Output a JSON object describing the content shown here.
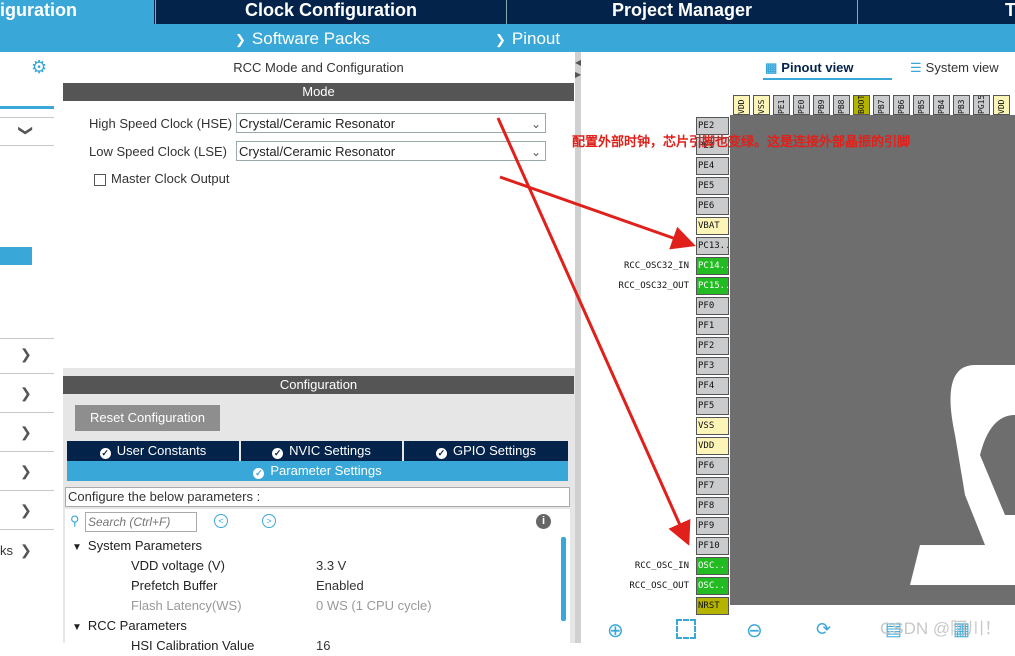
{
  "top_tabs": [
    "iguration",
    "Clock Configuration",
    "Project Manager",
    "T"
  ],
  "sub_menu": [
    "Software Packs",
    "Pinout"
  ],
  "rcc_panel": {
    "title": "RCC Mode and Configuration",
    "mode_header": "Mode",
    "hse_label": "High Speed Clock (HSE)",
    "hse_value": "Crystal/Ceramic Resonator",
    "lse_label": "Low Speed Clock (LSE)",
    "lse_value": "Crystal/Ceramic Resonator",
    "mco_label": "Master Clock Output"
  },
  "config_panel": {
    "header": "Configuration",
    "reset_button": "Reset Configuration",
    "tabs": [
      "User Constants",
      "NVIC Settings",
      "GPIO Settings"
    ],
    "active_tab": "Parameter Settings",
    "hint": "Configure the below parameters :",
    "search_placeholder": "Search (Ctrl+F)",
    "groups": [
      {
        "name": "System Parameters",
        "params": [
          {
            "name": "VDD voltage (V)",
            "value": "3.3 V"
          },
          {
            "name": "Prefetch Buffer",
            "value": "Enabled"
          },
          {
            "name": "Flash Latency(WS)",
            "value": "0 WS (1 CPU cycle)"
          }
        ]
      },
      {
        "name": "RCC Parameters",
        "params": [
          {
            "name": "HSI Calibration Value",
            "value": "16"
          }
        ]
      }
    ]
  },
  "sidebar": {
    "partial_label": "ks"
  },
  "view_tabs": {
    "pinout": "Pinout view",
    "system": "System view"
  },
  "left_pins": [
    {
      "name": "PE2",
      "color": "grey"
    },
    {
      "name": "PE3",
      "color": "grey"
    },
    {
      "name": "PE4",
      "color": "grey"
    },
    {
      "name": "PE5",
      "color": "grey"
    },
    {
      "name": "PE6",
      "color": "grey"
    },
    {
      "name": "VBAT",
      "color": "yellow"
    },
    {
      "name": "PC13..",
      "color": "grey"
    },
    {
      "name": "PC14..",
      "color": "green",
      "signal": "RCC_OSC32_IN"
    },
    {
      "name": "PC15..",
      "color": "green",
      "signal": "RCC_OSC32_OUT"
    },
    {
      "name": "PF0",
      "color": "grey"
    },
    {
      "name": "PF1",
      "color": "grey"
    },
    {
      "name": "PF2",
      "color": "grey"
    },
    {
      "name": "PF3",
      "color": "grey"
    },
    {
      "name": "PF4",
      "color": "grey"
    },
    {
      "name": "PF5",
      "color": "grey"
    },
    {
      "name": "VSS",
      "color": "yellow"
    },
    {
      "name": "VDD",
      "color": "yellow"
    },
    {
      "name": "PF6",
      "color": "grey"
    },
    {
      "name": "PF7",
      "color": "grey"
    },
    {
      "name": "PF8",
      "color": "grey"
    },
    {
      "name": "PF9",
      "color": "grey"
    },
    {
      "name": "PF10",
      "color": "grey"
    },
    {
      "name": "OSC..",
      "color": "green",
      "signal": "RCC_OSC_IN"
    },
    {
      "name": "OSC..",
      "color": "green",
      "signal": "RCC_OSC_OUT"
    },
    {
      "name": "NRST",
      "color": "olive"
    }
  ],
  "top_pins": [
    {
      "name": "VDD",
      "color": "yellow"
    },
    {
      "name": "VSS",
      "color": "yellow"
    },
    {
      "name": "PE1",
      "color": "grey"
    },
    {
      "name": "PE0",
      "color": "grey"
    },
    {
      "name": "PB9",
      "color": "grey"
    },
    {
      "name": "PB8",
      "color": "grey"
    },
    {
      "name": "BOOT0",
      "color": "olive"
    },
    {
      "name": "PB7",
      "color": "grey"
    },
    {
      "name": "PB6",
      "color": "grey"
    },
    {
      "name": "PB5",
      "color": "grey"
    },
    {
      "name": "PB4",
      "color": "grey"
    },
    {
      "name": "PB3",
      "color": "grey"
    },
    {
      "name": "PG15",
      "color": "grey"
    },
    {
      "name": "VDD",
      "color": "yellow"
    }
  ],
  "annotation": "配置外部时钟，芯片引脚也变绿。这是连接外部晶振的引脚",
  "watermark": "CSDN @阿川！",
  "colors": {
    "nav": "#03234b",
    "accent": "#39a8d8",
    "arrow": "#e0201a",
    "pin_green": "#22bb22"
  }
}
